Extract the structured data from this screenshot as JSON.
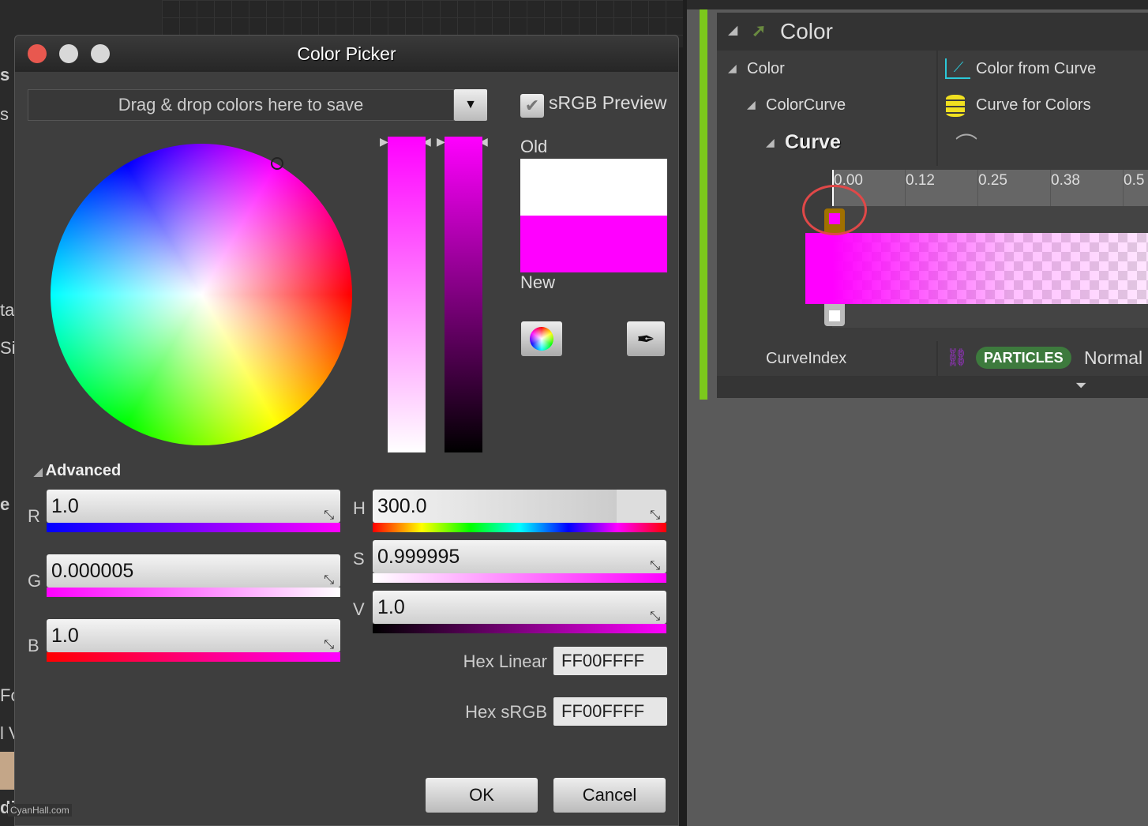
{
  "background": {
    "edge_fragments": [
      "s",
      "s",
      "ta",
      "Sir",
      "e",
      "Fo",
      "l V",
      "di"
    ],
    "watermark": "CyanHall.com"
  },
  "dialog": {
    "title": "Color Picker",
    "window_buttons": {
      "close_color": "#e8584f",
      "minimize_color": "#d8d8d8",
      "maximize_color": "#d8d8d8"
    },
    "drop_zone": "Drag & drop colors here to save",
    "srgb_preview": {
      "label": "sRGB Preview",
      "checked": true
    },
    "old_label": "Old",
    "new_label": "New",
    "old_color": "#FFFFFF",
    "new_color": "#FF00FF",
    "advanced_label": "Advanced",
    "rgb": [
      {
        "label": "R",
        "value": "1.0"
      },
      {
        "label": "G",
        "value": "0.000005"
      },
      {
        "label": "B",
        "value": "1.0"
      }
    ],
    "hsv": [
      {
        "label": "H",
        "value": "300.0"
      },
      {
        "label": "S",
        "value": "0.999995"
      },
      {
        "label": "V",
        "value": "1.0"
      }
    ],
    "hex_linear": {
      "label": "Hex Linear",
      "value": "FF00FFFF"
    },
    "hex_srgb": {
      "label": "Hex sRGB",
      "value": "FF00FFFF"
    },
    "ok": "OK",
    "cancel": "Cancel"
  },
  "details": {
    "section": "Color",
    "rows": [
      {
        "label": "Color",
        "value": "Color from Curve",
        "icon": "curve-chart-icon"
      },
      {
        "label": "ColorCurve",
        "value": "Curve for Colors",
        "icon": "database-icon"
      },
      {
        "label": "Curve",
        "icon": "curve-edit-icon"
      }
    ],
    "ruler_ticks": [
      "0.00",
      "0.12",
      "0.25",
      "0.38",
      "0.5"
    ],
    "curve_index": {
      "label": "CurveIndex",
      "badge": "PARTICLES",
      "value": "Normal"
    }
  }
}
